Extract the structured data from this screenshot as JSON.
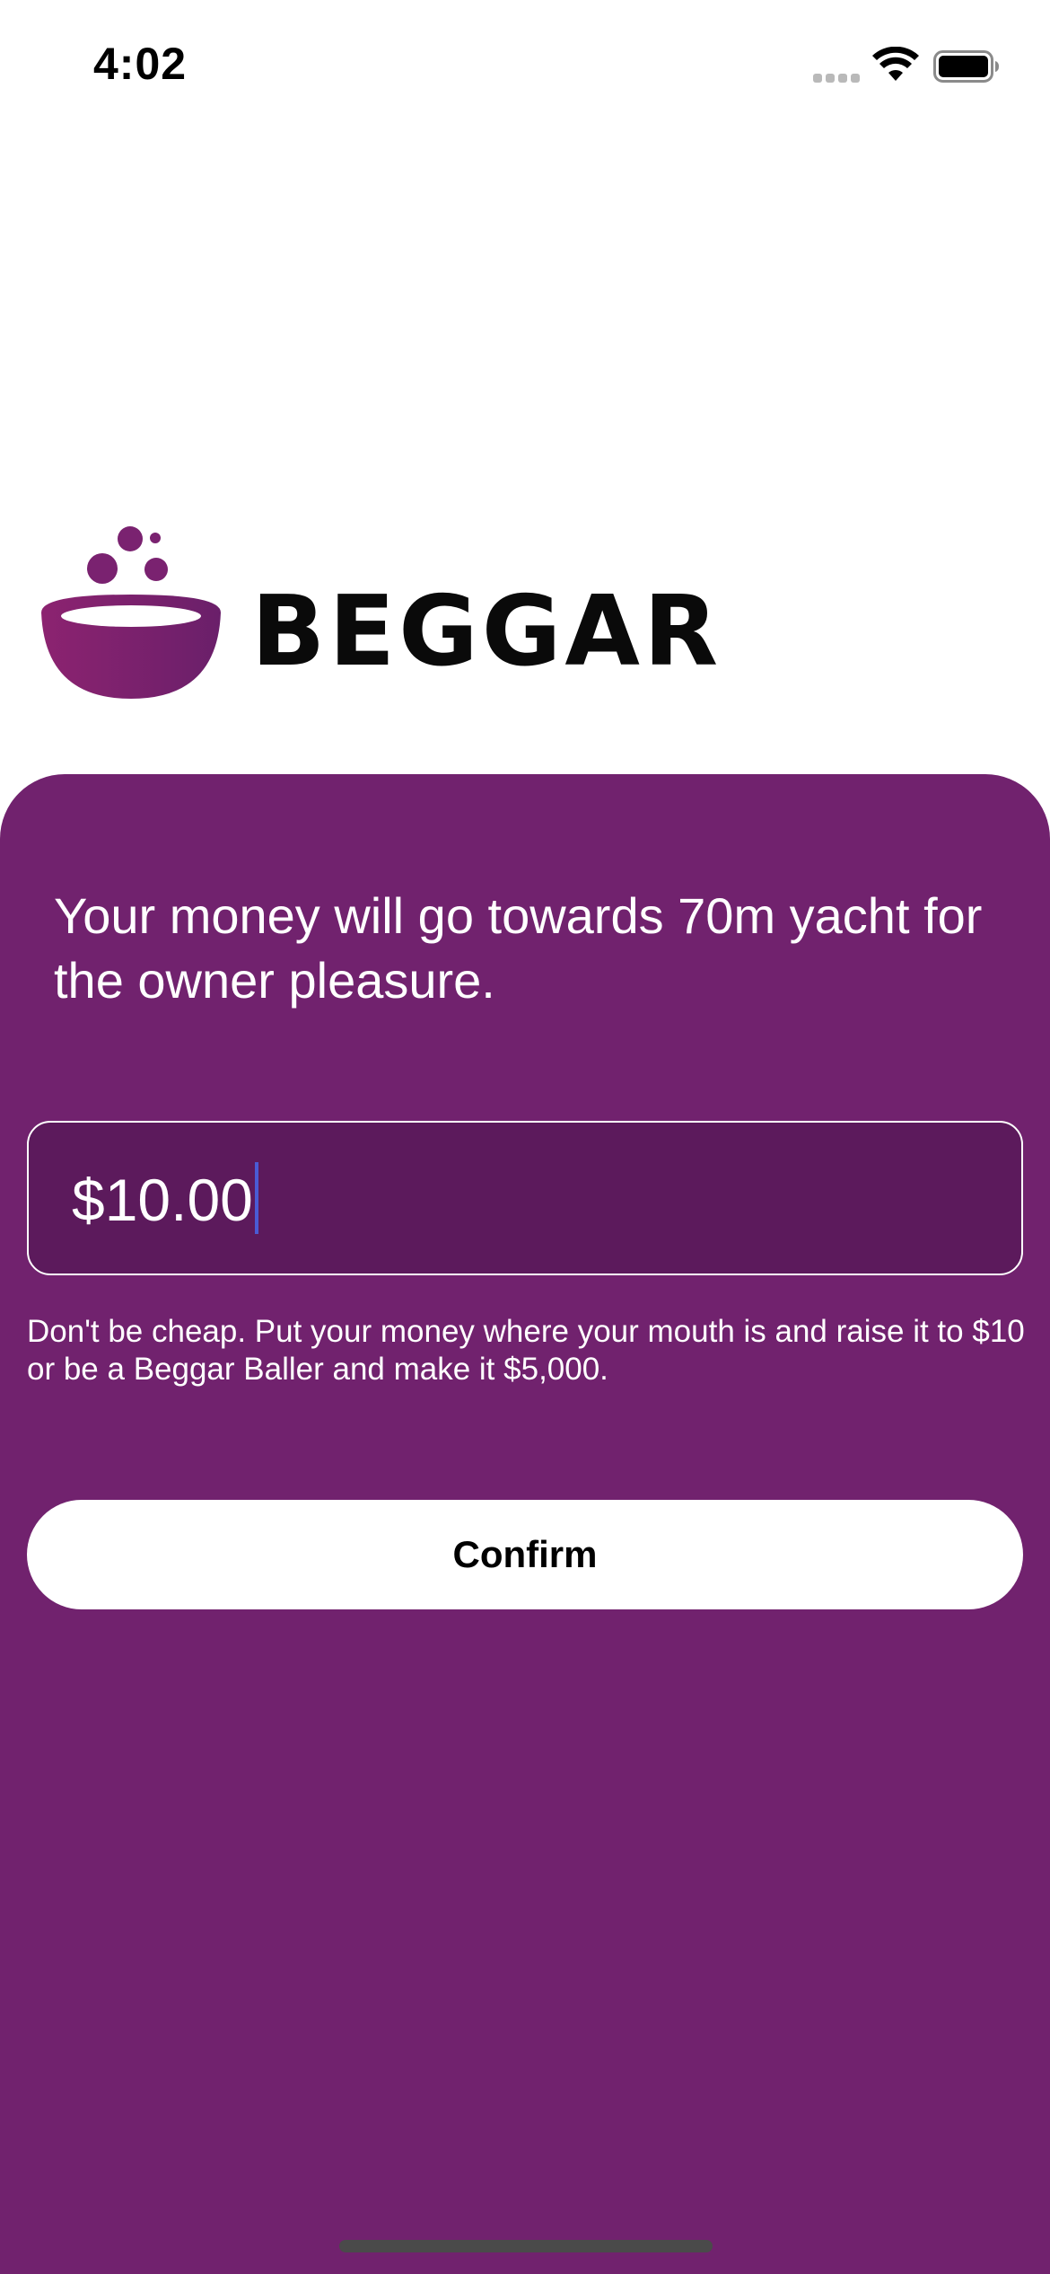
{
  "status_bar": {
    "time": "4:02",
    "icons": [
      "cellular-signal-icon",
      "wifi-icon",
      "battery-icon"
    ]
  },
  "logo": {
    "wordmark": "BEGGAR",
    "icon": "bowl-icon"
  },
  "panel": {
    "headline": "Your money will go towards 70m yacht for the owner pleasure.",
    "amount_field": {
      "value": "$10.00"
    },
    "hint": "Don't be cheap. Put your money where your mouth is and raise it to $10 or be a Beggar Baller and make it $5,000.",
    "confirm_label": "Confirm"
  },
  "colors": {
    "panel_background": "#71226e",
    "field_background": "#5c1a5c",
    "caret": "#4a5bd4",
    "logo_gradient_start": "#8c2370",
    "logo_gradient_end": "#6a1f6a"
  }
}
